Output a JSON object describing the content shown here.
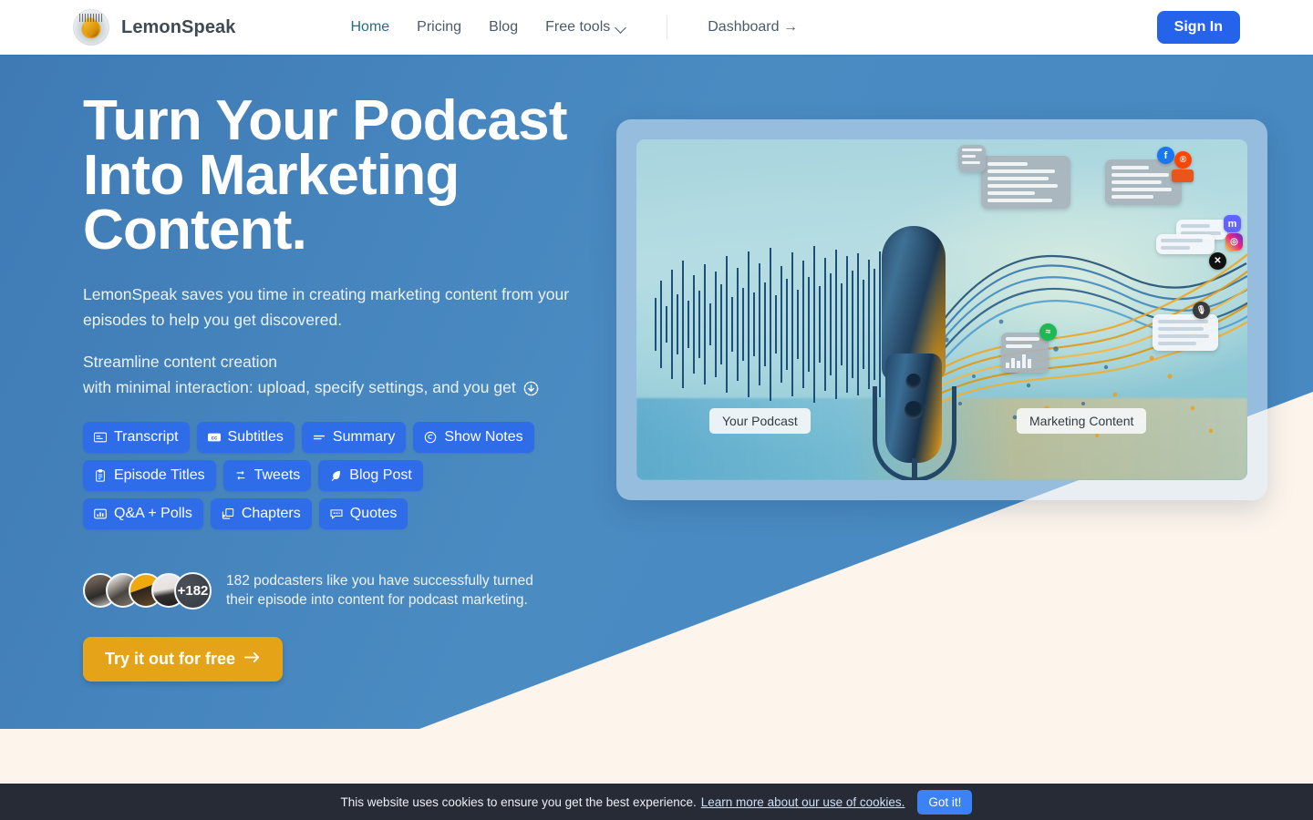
{
  "brand": {
    "name": "LemonSpeak",
    "logo_icon": "lemon-microphone-logo"
  },
  "nav": {
    "items": [
      {
        "label": "Home",
        "active": true
      },
      {
        "label": "Pricing",
        "active": false
      },
      {
        "label": "Blog",
        "active": false
      },
      {
        "label": "Free tools",
        "active": false,
        "has_dropdown": true
      },
      {
        "label": "Dashboard →",
        "active": false
      }
    ],
    "signin_label": "Sign In"
  },
  "hero": {
    "headline": "Turn Your Podcast\nInto Marketing\nContent.",
    "subtitle": "LemonSpeak saves you time in creating marketing content from your episodes to help you get discovered.",
    "streamline_line1": "Streamline content creation",
    "streamline_line2": "with minimal interaction: upload, specify settings, and you get",
    "streamline_icon": "arrow-down-circle-icon",
    "tags": [
      {
        "label": "Transcript",
        "icon": "transcript-icon"
      },
      {
        "label": "Subtitles",
        "icon": "closed-caption-icon"
      },
      {
        "label": "Summary",
        "icon": "summary-lines-icon"
      },
      {
        "label": "Show Notes",
        "icon": "show-notes-icon"
      },
      {
        "label": "Episode Titles",
        "icon": "clipboard-icon"
      },
      {
        "label": "Tweets",
        "icon": "tweet-icon"
      },
      {
        "label": "Blog Post",
        "icon": "feather-pen-icon"
      },
      {
        "label": "Q&A + Polls",
        "icon": "bar-chart-icon"
      },
      {
        "label": "Chapters",
        "icon": "chapters-icon"
      },
      {
        "label": "Quotes",
        "icon": "quote-bubble-icon"
      }
    ],
    "proof": {
      "avatar_count": 4,
      "more_count": "+182",
      "text": "182 podcasters like you have successfully turned their episode into content for podcast marketing."
    },
    "cta_label": "Try it out for free",
    "cta_icon": "arrow-right-icon"
  },
  "hero_image": {
    "left_label": "Your Podcast",
    "right_label": "Marketing Content",
    "social_icons": [
      "facebook-icon",
      "reddit-icon",
      "mastodon-icon",
      "instagram-icon",
      "x-twitter-icon",
      "spotify-icon",
      "podcast-mic-icon"
    ],
    "alt": "Blue and gold studio microphone with audio waveform transforming into marketing content cards"
  },
  "cookie": {
    "text": "This website uses cookies to ensure you get the best experience.",
    "link": "Learn more about our use of cookies.",
    "button": "Got it!"
  },
  "colors": {
    "hero_blue": "#4688c0",
    "cream": "#fdf5ec",
    "accent_blue": "#2563eb",
    "tag_blue": "#2f6ce8",
    "cta_amber": "#e5a417",
    "nav_active": "#2a6a82",
    "cookie_bar": "#262b36"
  }
}
